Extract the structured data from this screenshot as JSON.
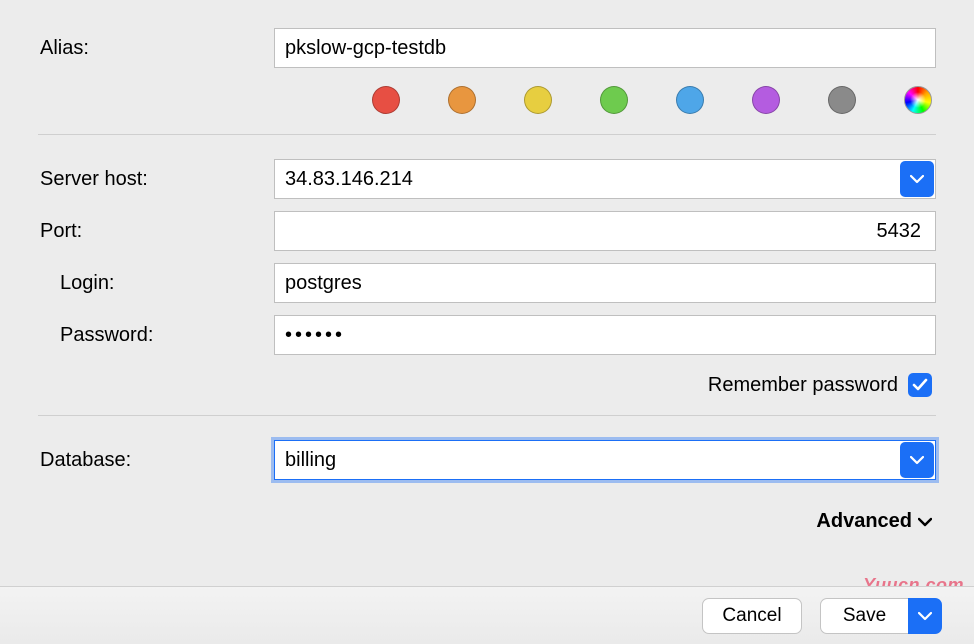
{
  "form": {
    "alias": {
      "label": "Alias:",
      "value": "pkslow-gcp-testdb"
    },
    "serverHost": {
      "label": "Server host:",
      "value": "34.83.146.214"
    },
    "port": {
      "label": "Port:",
      "value": "5432"
    },
    "login": {
      "label": "Login:",
      "value": "postgres"
    },
    "password": {
      "label": "Password:",
      "value": "••••••"
    },
    "remember": {
      "label": "Remember password",
      "checked": true
    },
    "database": {
      "label": "Database:",
      "value": "billing"
    },
    "advanced": {
      "label": "Advanced"
    }
  },
  "colors": {
    "red": "#e74f43",
    "orange": "#e8963f",
    "yellow": "#e7ce40",
    "green": "#6ecb4e",
    "blue": "#4ea6e8",
    "purple": "#b45ce0",
    "gray": "#8a8a8a"
  },
  "footer": {
    "cancel": "Cancel",
    "save": "Save"
  },
  "watermark": "Yuucn.com"
}
